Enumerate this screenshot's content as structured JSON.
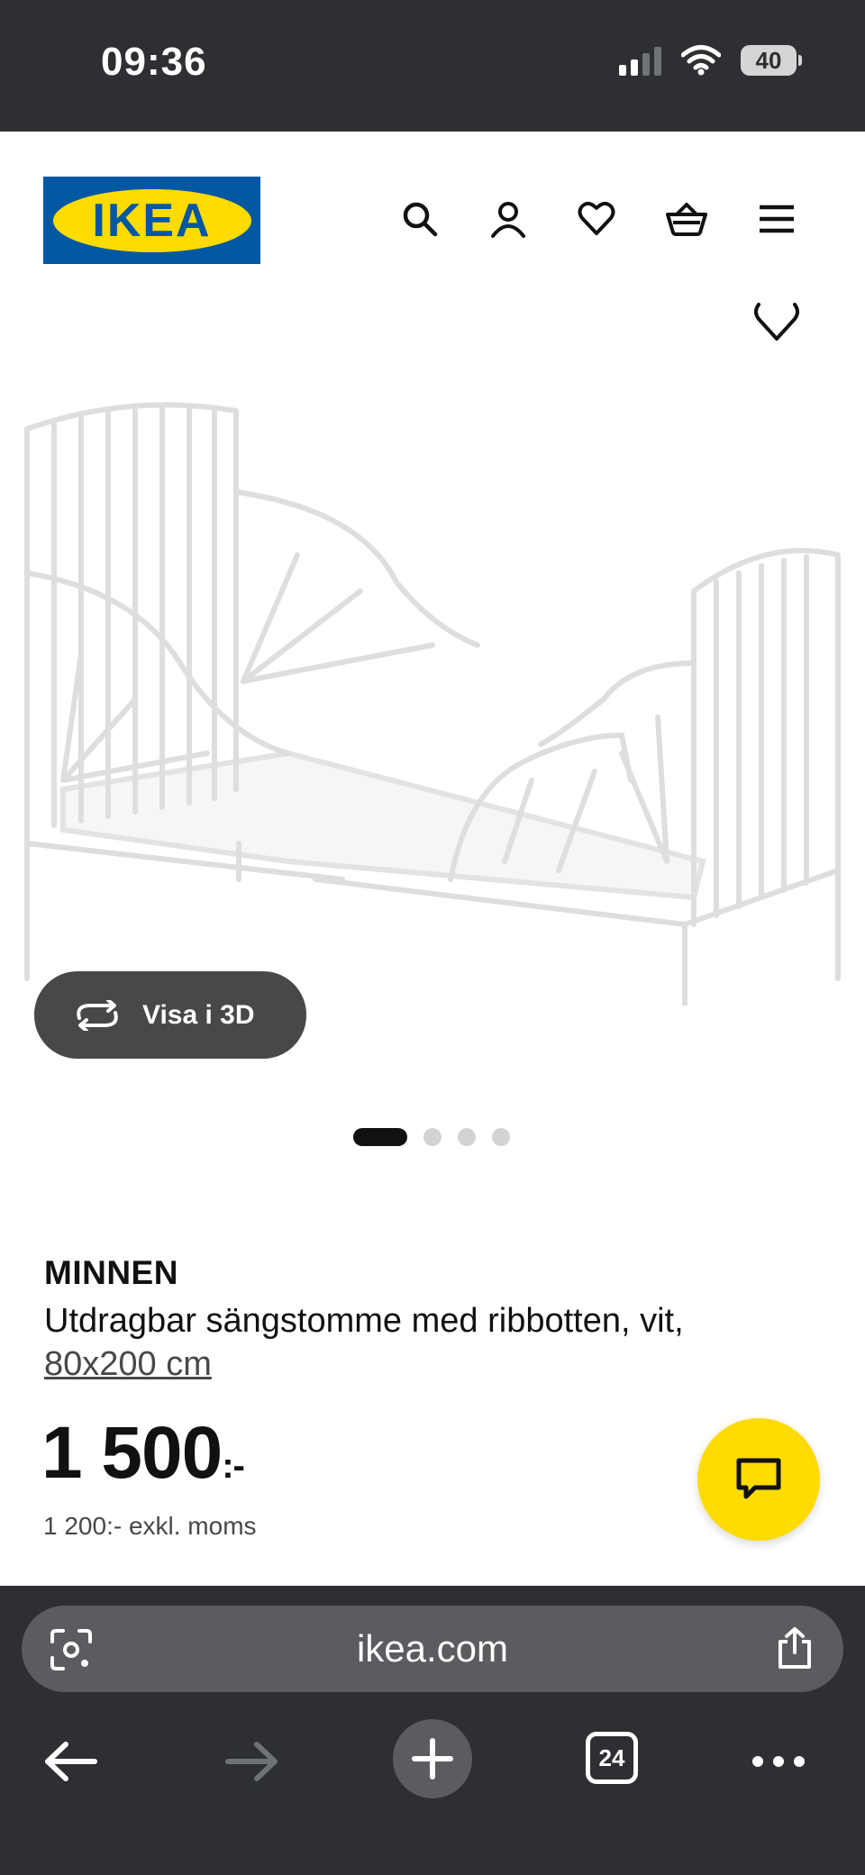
{
  "status_bar": {
    "time": "09:36",
    "battery": "40",
    "icons": [
      "cellular-signal-icon",
      "wifi-icon",
      "battery-icon"
    ]
  },
  "header": {
    "logo_text": "IKEA",
    "icons": [
      "search-icon",
      "account-icon",
      "heart-icon",
      "basket-icon",
      "menu-icon"
    ]
  },
  "gallery": {
    "view_3d_label": "Visa i 3D",
    "image_count": 4,
    "active_image": 1
  },
  "product": {
    "name": "MINNEN",
    "description": "Utdragbar sängstomme med ribbotten, vit,",
    "size": "80x200 cm",
    "price": "1 500",
    "price_suffix": ":-",
    "price_ex_vat": "1 200:- exkl. moms"
  },
  "browser": {
    "url": "ikea.com",
    "tabs_count": "24"
  },
  "colors": {
    "ikea_blue": "#0058a3",
    "ikea_yellow": "#ffdb00",
    "chrome_dark": "#2d2f32",
    "chrome_field": "#5a5c5f"
  }
}
